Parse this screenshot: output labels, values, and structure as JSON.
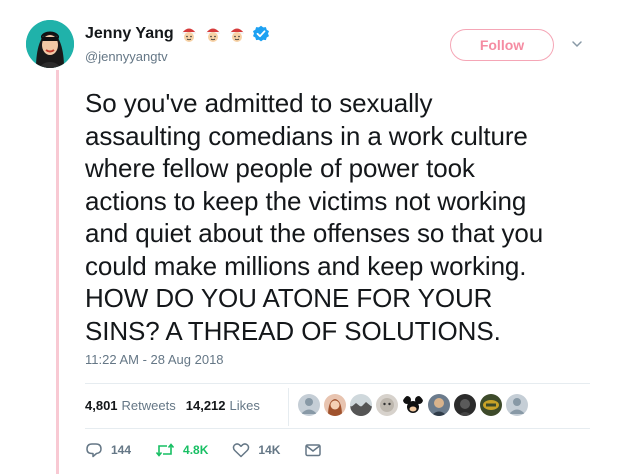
{
  "user": {
    "name": "Jenny Yang",
    "handle": "@jennyyangtv",
    "emoji_icons": [
      "face-with-red-hat-icon",
      "face-with-red-hat-icon",
      "face-with-red-hat-icon"
    ],
    "verified_icon": "verified-badge-icon"
  },
  "follow_button": {
    "label": "Follow",
    "color": "#f58ca2"
  },
  "tweet": {
    "text": "So you've admitted to sexually\nassaulting comedians in a work culture\nwhere fellow people of power took\nactions to keep the victims not working\nand quiet about the offenses so that you\ncould make millions and keep working.\nHOW DO YOU ATONE FOR YOUR\nSINS? A THREAD OF SOLUTIONS.",
    "timestamp": "11:22 AM - 28 Aug 2018"
  },
  "stats": {
    "retweets_count": "4,801",
    "retweets_label": "Retweets",
    "likes_count": "14,212",
    "likes_label": "Likes"
  },
  "liker_avatars": [
    "default-avatar",
    "woman-avatar",
    "landscape-avatar",
    "cartoon-avatar",
    "mickey-avatar",
    "man-avatar",
    "dark-avatar",
    "brand-avatar",
    "default-avatar"
  ],
  "actions": {
    "reply_count": "144",
    "retweet_count": "4.8K",
    "like_count": "14K"
  },
  "colors": {
    "thread_line": "#f8c9d3",
    "retweet_active": "#17bf63",
    "muted": "#657786",
    "verified": "#1da1f2"
  }
}
